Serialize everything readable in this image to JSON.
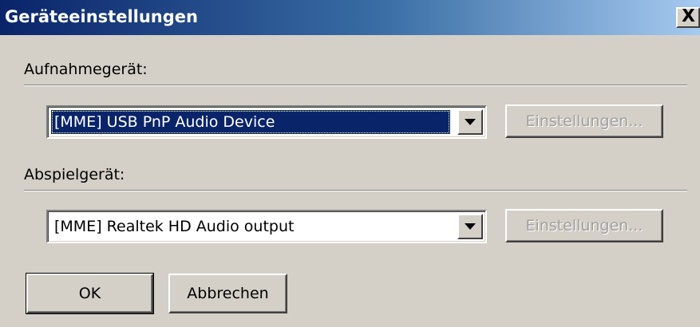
{
  "window": {
    "title": "Geräteeinstellungen",
    "close_label": "X"
  },
  "recording": {
    "label": "Aufnahmegerät:",
    "device": "[MME] USB PnP Audio Device",
    "settings_label": "Einstellungen..."
  },
  "playback": {
    "label": "Abspielgerät:",
    "device": "[MME] Realtek HD Audio output",
    "settings_label": "Einstellungen..."
  },
  "buttons": {
    "ok": "OK",
    "cancel": "Abbrechen"
  },
  "colors": {
    "titlebar_start": "#0a246a",
    "titlebar_end": "#a6caf0",
    "dialog_bg": "#d4d0c8",
    "selection": "#0a246a"
  }
}
